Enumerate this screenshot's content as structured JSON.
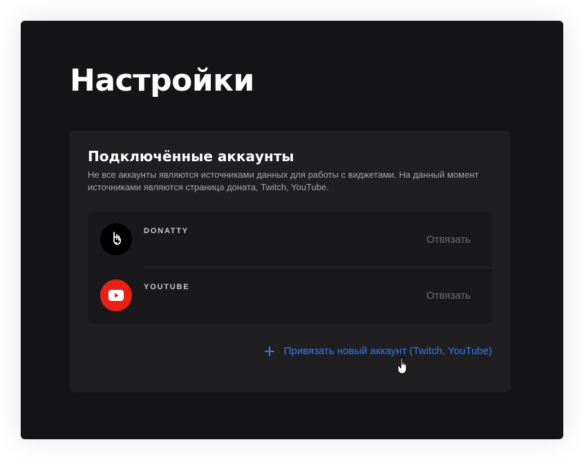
{
  "page": {
    "title": "Настройки"
  },
  "connected_accounts": {
    "title": "Подключённые аккаунты",
    "description": "Не все аккаунты являются источниками данных для работы с виджетами. На данный момент источниками являются страница доната, Twitch, YouTube.",
    "accounts": [
      {
        "name": "DONATTY",
        "icon": "donatty-logo-icon",
        "icon_bg": "#000000",
        "unlink_label": "Отвязать"
      },
      {
        "name": "YOUTUBE",
        "icon": "youtube-logo-icon",
        "icon_bg": "#e62117",
        "unlink_label": "Отвязать"
      }
    ],
    "add_account_label": "Привязать новый аккаунт (Twitch, YouTube)"
  },
  "colors": {
    "background": "#141416",
    "card": "#1f1f22",
    "accent": "#2f7bf5",
    "youtube_red": "#e62117"
  }
}
